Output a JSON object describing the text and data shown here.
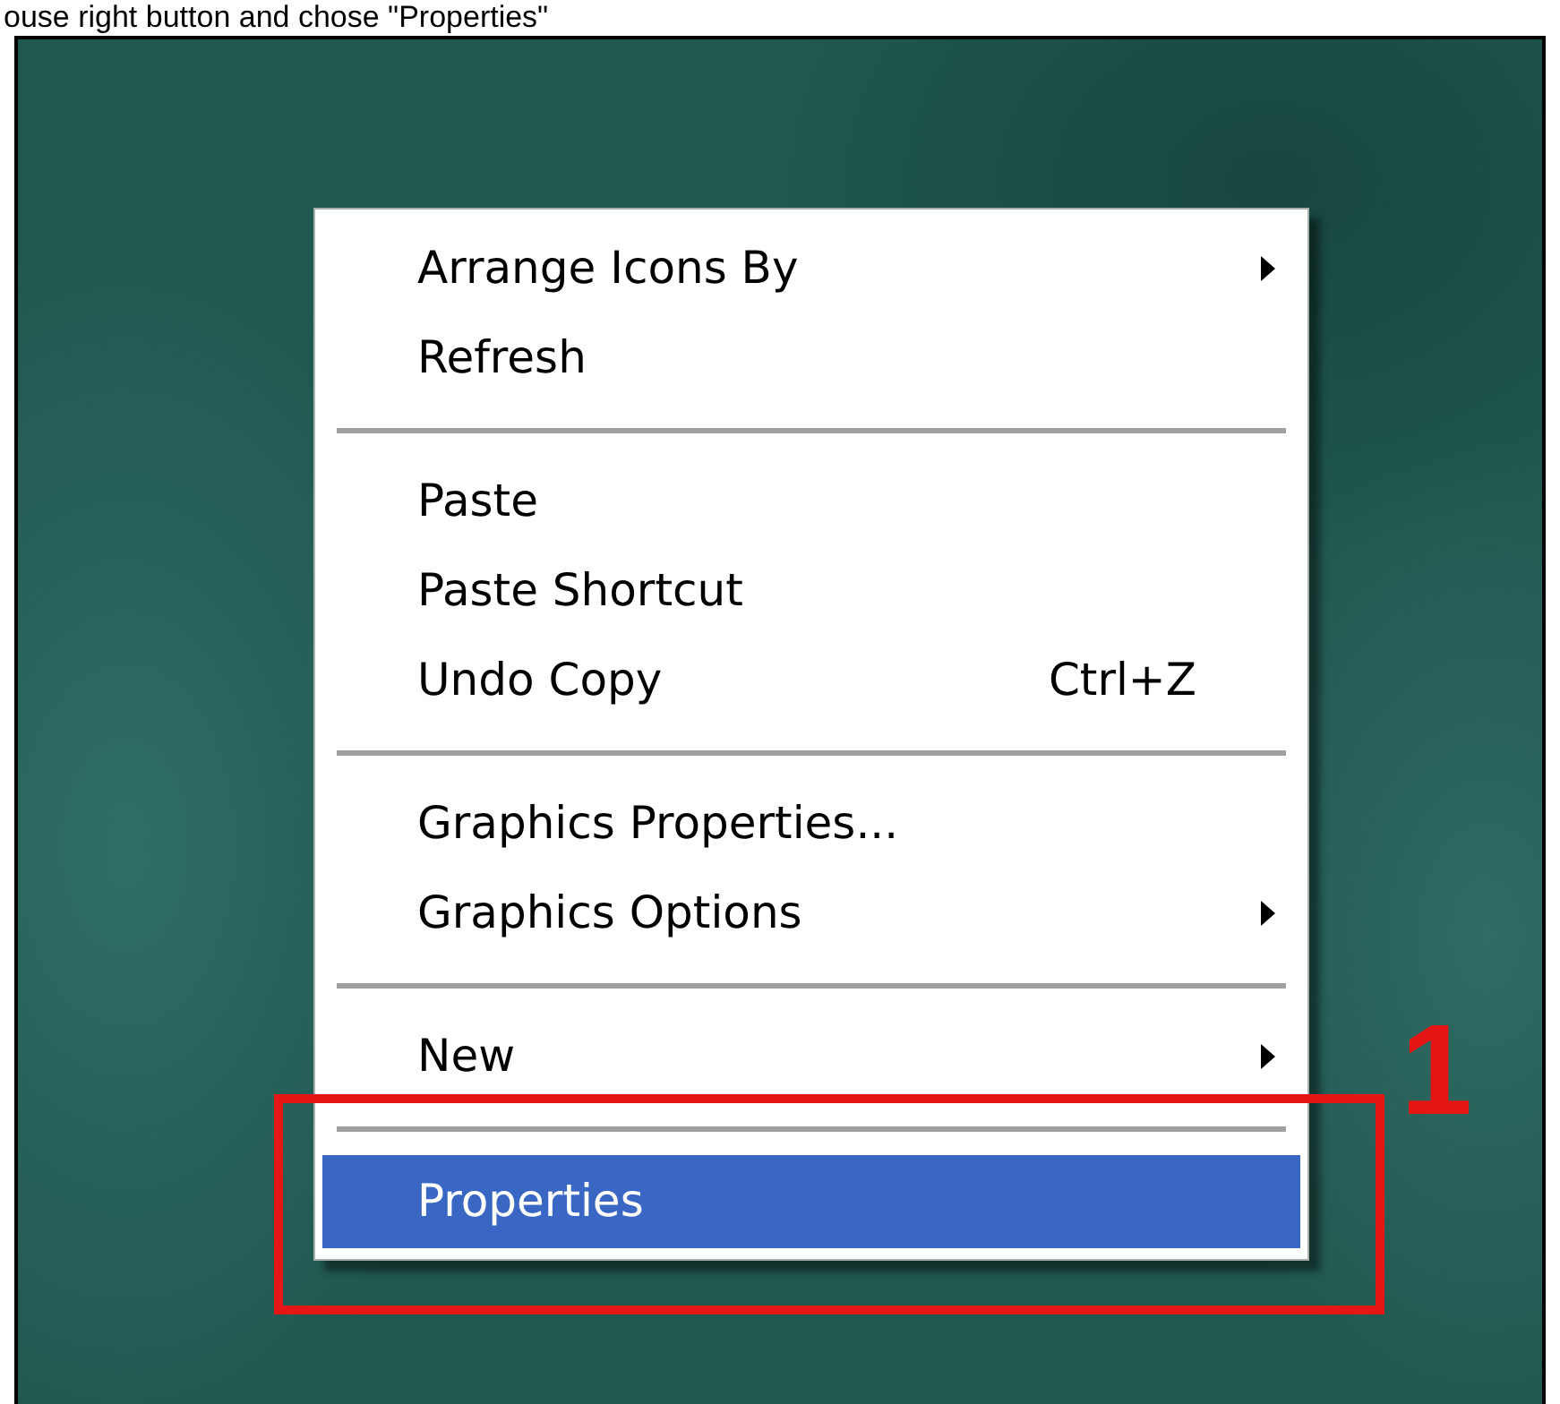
{
  "caption": "ouse right button and chose \"Properties\"",
  "context_menu": {
    "items": [
      {
        "kind": "item",
        "label": "Arrange Icons By",
        "submenu": true,
        "selected": false
      },
      {
        "kind": "item",
        "label": "Refresh",
        "submenu": false,
        "selected": false
      },
      {
        "kind": "separator"
      },
      {
        "kind": "item",
        "label": "Paste",
        "submenu": false,
        "selected": false
      },
      {
        "kind": "item",
        "label": "Paste Shortcut",
        "submenu": false,
        "selected": false
      },
      {
        "kind": "item",
        "label": "Undo Copy",
        "shortcut": "Ctrl+Z",
        "submenu": false,
        "selected": false
      },
      {
        "kind": "separator"
      },
      {
        "kind": "item",
        "label": "Graphics Properties...",
        "submenu": false,
        "selected": false
      },
      {
        "kind": "item",
        "label": "Graphics Options",
        "submenu": true,
        "selected": false
      },
      {
        "kind": "separator"
      },
      {
        "kind": "item",
        "label": "New",
        "submenu": true,
        "selected": false
      },
      {
        "kind": "separator"
      },
      {
        "kind": "item",
        "label": "Properties",
        "submenu": false,
        "selected": true
      }
    ]
  },
  "callout": {
    "label": "1"
  }
}
